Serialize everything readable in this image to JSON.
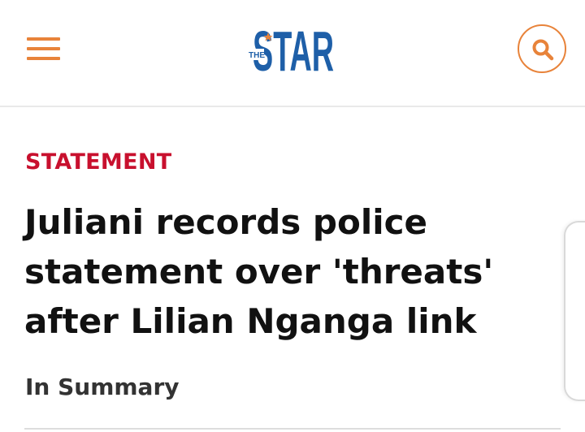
{
  "header": {
    "menu_icon": "hamburger-menu-icon",
    "logo": {
      "prefix": "THE",
      "name": "STAR"
    },
    "search_icon": "search-icon"
  },
  "article": {
    "kicker": "STATEMENT",
    "headline_lines": [
      "Juliani records police",
      "statement over 'threats'",
      "after Lilian Nganga link"
    ],
    "summary_label": "In Summary"
  },
  "colors": {
    "accent": "#e8833a",
    "kicker": "#c8102e",
    "logo_blue": "#1e5fa8",
    "text": "#111111"
  }
}
